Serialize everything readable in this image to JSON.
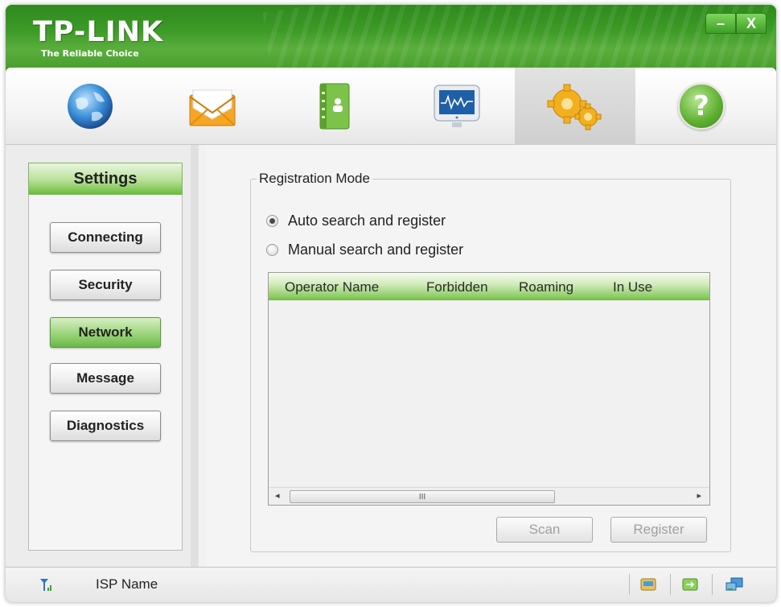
{
  "app": {
    "logo": "TP-LINK",
    "tagline": "The Reliable Choice",
    "window_buttons": {
      "minimize": "–",
      "close": "X"
    }
  },
  "toolbar": {
    "items": [
      {
        "icon": "globe-icon"
      },
      {
        "icon": "envelope-icon"
      },
      {
        "icon": "contacts-book-icon"
      },
      {
        "icon": "monitor-icon"
      },
      {
        "icon": "gears-icon",
        "active": true
      },
      {
        "icon": "help-icon",
        "glyph": "?"
      }
    ]
  },
  "sidebar": {
    "title": "Settings",
    "items": [
      {
        "label": "Connecting"
      },
      {
        "label": "Security"
      },
      {
        "label": "Network",
        "active": true
      },
      {
        "label": "Message"
      },
      {
        "label": "Diagnostics"
      }
    ]
  },
  "main": {
    "group_title": "Registration Mode",
    "options": [
      {
        "label": "Auto search and register",
        "selected": true
      },
      {
        "label": "Manual search and register",
        "selected": false
      }
    ],
    "table": {
      "columns": [
        "Operator Name",
        "Forbidden",
        "Roaming",
        "In Use"
      ],
      "rows": [],
      "scroll_grip": "III",
      "scroll_left": "◂",
      "scroll_right": "▸"
    },
    "buttons": {
      "scan": "Scan",
      "register": "Register"
    }
  },
  "status": {
    "isp_name": "ISP Name",
    "icons": [
      "signal-icon",
      "sms-icon",
      "connection-icon",
      "network-icon"
    ]
  },
  "colors": {
    "brand_green": "#3c9a27",
    "header_green": "#7cc450"
  }
}
